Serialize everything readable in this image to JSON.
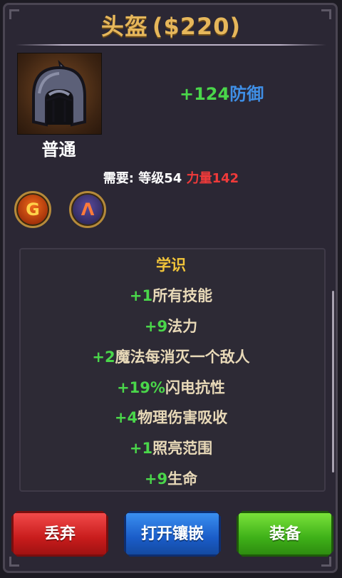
{
  "title": {
    "name": "头盔",
    "price": "($220)"
  },
  "item": {
    "icon": "helmet-icon",
    "rarity": "普通",
    "main_stat": {
      "value": "+124",
      "name": "防御"
    }
  },
  "requirements": {
    "label": "需要:",
    "level_label": "等级54",
    "strength_label": "力量142"
  },
  "sockets": [
    {
      "icon": "fire-rune-icon",
      "glyph": "G"
    },
    {
      "icon": "arcane-rune-icon",
      "glyph": "Λ"
    }
  ],
  "properties": {
    "title": "学识",
    "lines": [
      {
        "value": "+1",
        "text": "所有技能"
      },
      {
        "value": "+9",
        "text": "法力"
      },
      {
        "value": "+2",
        "text": "魔法每消灭一个敌人"
      },
      {
        "value": "+19%",
        "text": "闪电抗性"
      },
      {
        "value": "+4",
        "text": "物理伤害吸收"
      },
      {
        "value": "+1",
        "text": "照亮范围"
      },
      {
        "value": "+9",
        "text": "生命"
      }
    ]
  },
  "buttons": {
    "discard": "丢弃",
    "open_socket": "打开镶嵌",
    "equip": "装备"
  },
  "colors": {
    "title_gold": "#e6b75b",
    "stat_green": "#4ad64a",
    "stat_blue": "#3f8fe6",
    "requirement_red": "#ef3a3a",
    "property_title_yellow": "#f2c53a"
  }
}
